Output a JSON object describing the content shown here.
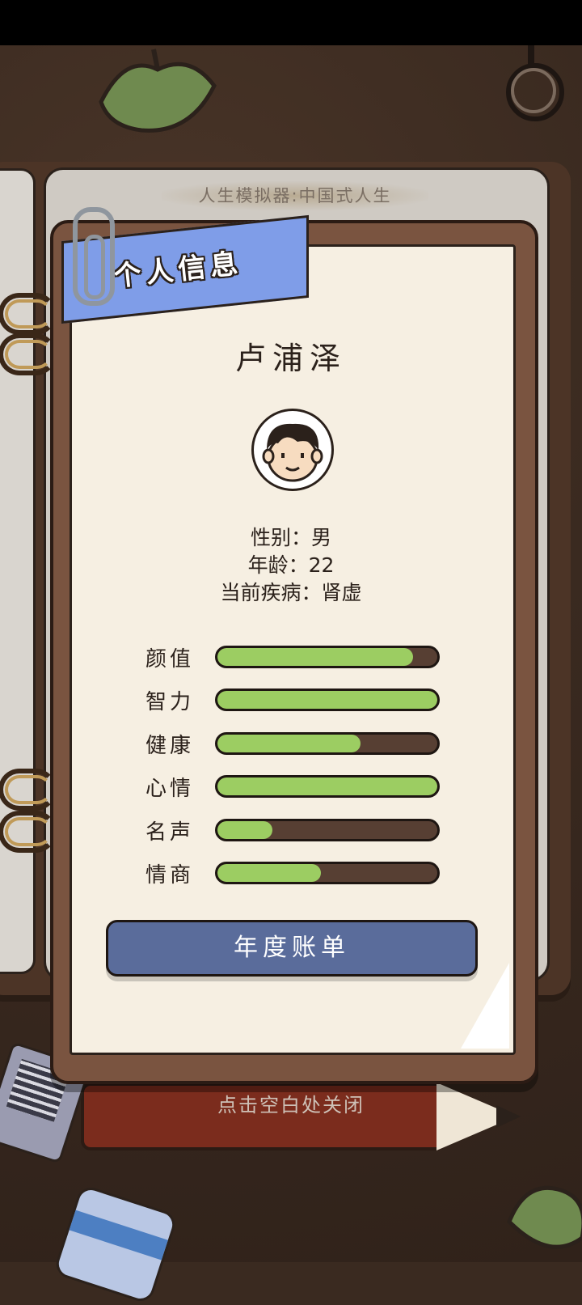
{
  "book": {
    "title": "人生模拟器:中国式人生"
  },
  "panel": {
    "tab_label": "个人信息",
    "name": "卢浦泽",
    "info": {
      "gender": "性别：男",
      "age": "年龄：22",
      "disease": "当前疾病：肾虚"
    },
    "stats": [
      {
        "label": "颜值",
        "value": 0.89
      },
      {
        "label": "智力",
        "value": 1.0
      },
      {
        "label": "健康",
        "value": 0.65
      },
      {
        "label": "心情",
        "value": 1.0
      },
      {
        "label": "名声",
        "value": 0.25
      },
      {
        "label": "情商",
        "value": 0.47
      }
    ],
    "report_button": "年度账单"
  },
  "close_hint": "点击空白处关闭",
  "colors": {
    "bar_fill": "#9ccd62",
    "bar_bg": "#573f33",
    "button": "#5a6c9b",
    "tab": "#7f9de8"
  },
  "icons": [
    "leaf-icon",
    "ring-icon",
    "paper-clip-icon",
    "avatar-icon",
    "qr-code-icon",
    "pencil-icon",
    "eraser-icon"
  ]
}
